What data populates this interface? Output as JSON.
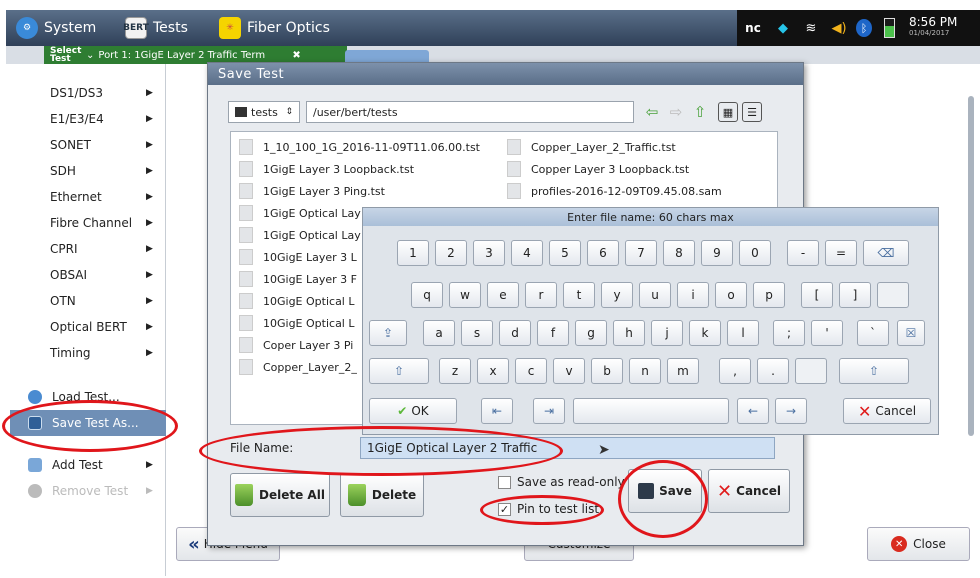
{
  "topbar": {
    "system_label": "System",
    "bert_badge": "BERT",
    "tests_label": "Tests",
    "fiber_label": "Fiber Optics",
    "nc_label": "nc",
    "time": "8:56 PM",
    "date": "01/04/2017"
  },
  "tabs": {
    "select_label": "Select Test",
    "port_label": "Port 1: 1GigE Layer 2 Traffic Term"
  },
  "sidebar": {
    "items": [
      {
        "label": "DS1/DS3"
      },
      {
        "label": "E1/E3/E4"
      },
      {
        "label": "SONET"
      },
      {
        "label": "SDH"
      },
      {
        "label": "Ethernet"
      },
      {
        "label": "Fibre Channel"
      },
      {
        "label": "CPRI"
      },
      {
        "label": "OBSAI"
      },
      {
        "label": "OTN"
      },
      {
        "label": "Optical BERT"
      },
      {
        "label": "Timing"
      }
    ],
    "load_test": "Load Test...",
    "save_test_as": "Save Test As...",
    "add_test": "Add Test",
    "remove_test": "Remove Test"
  },
  "background": {
    "hide_menu": "Hide Menu",
    "customize": "Customize",
    "close": "Close"
  },
  "dialog": {
    "title": "Save Test",
    "folder": "tests",
    "path": "/user/bert/tests",
    "files_left": [
      "1_10_100_1G_2016-11-09T11.06.00.tst",
      "1GigE Layer 3 Loopback.tst",
      "1GigE Layer 3 Ping.tst",
      "1GigE Optical Lay",
      "1GigE Optical Lay",
      "10GigE Layer 3 L",
      "10GigE Layer 3 F",
      "10GigE Optical L",
      "10GigE Optical L",
      "Coper Layer 3 Pi",
      "Copper_Layer_2_"
    ],
    "files_right": [
      "Copper_Layer_2_Traffic.tst",
      "Copper Layer 3 Loopback.tst",
      "profiles-2016-12-09T09.45.08.sam"
    ],
    "file_name_label": "File Name:",
    "file_name_value": "1GigE Optical Layer 2 Traffic",
    "delete_all": "Delete All",
    "delete": "Delete",
    "save_readonly": "Save as read-only",
    "pin_to_list": "Pin to test list",
    "save": "Save",
    "cancel": "Cancel"
  },
  "keyboard": {
    "title": "Enter file name: 60 chars max",
    "row1": [
      "1",
      "2",
      "3",
      "4",
      "5",
      "6",
      "7",
      "8",
      "9",
      "0",
      "-",
      "="
    ],
    "row2": [
      "q",
      "w",
      "e",
      "r",
      "t",
      "y",
      "u",
      "i",
      "o",
      "p",
      "[",
      "]"
    ],
    "row3": [
      "a",
      "s",
      "d",
      "f",
      "g",
      "h",
      "j",
      "k",
      "l",
      ";",
      "'",
      "`"
    ],
    "row4": [
      "z",
      "x",
      "c",
      "v",
      "b",
      "n",
      "m",
      ",",
      "."
    ],
    "ok": "OK",
    "cancel": "Cancel"
  },
  "colors": {
    "accent_green": "#2e7d32",
    "annotation_red": "#e0161b",
    "title_blue": "#5a6e88"
  }
}
